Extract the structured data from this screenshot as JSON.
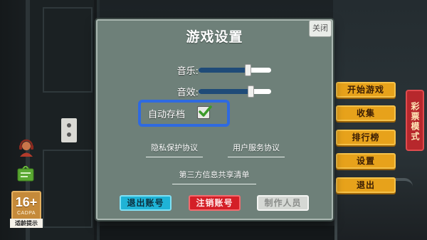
{
  "dialog": {
    "title": "游戏设置",
    "close_label": "关闭",
    "music_label": "音乐:",
    "music_level": 0.68,
    "sfx_label": "音效:",
    "sfx_level": 0.72,
    "autosave_label": "自动存档",
    "autosave_checked": true,
    "privacy_link": "隐私保护协议",
    "service_link": "用户服务协议",
    "third_party_link": "第三方信息共享清单",
    "logout_button": "退出账号",
    "delete_button": "注销账号",
    "credits_button": "制作人员"
  },
  "menu": {
    "items": [
      "开始游戏",
      "收集",
      "排行榜",
      "设置",
      "退出"
    ],
    "lottery_label": "彩票模式"
  },
  "hud": {
    "age_rating": "16+",
    "age_org": "CADPA",
    "age_tip": "适龄提示"
  },
  "colors": {
    "dialog_bg": "#6e8079",
    "menu_orange": "#e7a21b",
    "lottery_red": "#b7282c",
    "highlight_blue": "#2f6ae0",
    "logout_cyan": "#1fb3d6",
    "delete_red": "#d41f27"
  }
}
